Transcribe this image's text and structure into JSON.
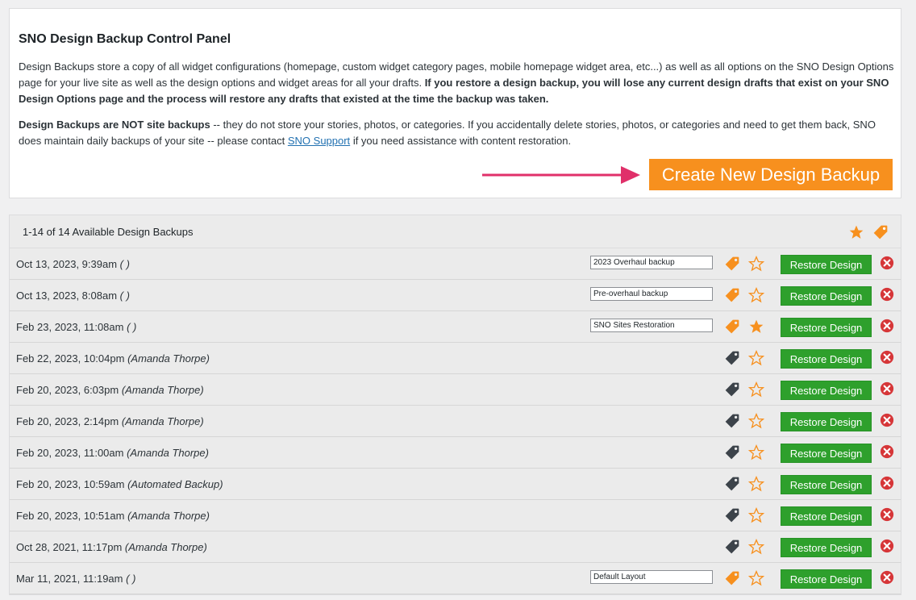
{
  "panel": {
    "title": "SNO Design Backup Control Panel",
    "p1_text": "Design Backups store a copy of all widget configurations (homepage, custom widget category pages, mobile homepage widget area, etc...) as well as all options on the SNO Design Options page for your live site as well as the design options and widget areas for all your drafts.",
    "p1_bold": "If you restore a design backup, you will lose any current design drafts that exist on your SNO Design Options page and the process will restore any drafts that existed at the time the backup was taken.",
    "p2_bold": "Design Backups are NOT site backups",
    "p2_text": "-- they do not store your stories, photos, or categories. If you accidentally delete stories, photos, or categories and need to get them back, SNO does maintain daily backups of your site -- please contact",
    "p2_link": "SNO Support",
    "p2_tail": "if you need assistance with content restoration.",
    "create_button": "Create New Design Backup"
  },
  "list": {
    "count_label": "1-14 of 14 Available Design Backups",
    "restore_label": "Restore Design",
    "rows": [
      {
        "date": "Oct 13, 2023, 9:39am",
        "author": "( )",
        "note": "2023 Overhaul backup",
        "tagged": true,
        "starred": false
      },
      {
        "date": "Oct 13, 2023, 8:08am",
        "author": "( )",
        "note": "Pre-overhaul backup",
        "tagged": true,
        "starred": false
      },
      {
        "date": "Feb 23, 2023, 11:08am",
        "author": "( )",
        "note": "SNO Sites Restoration",
        "tagged": true,
        "starred": true
      },
      {
        "date": "Feb 22, 2023, 10:04pm",
        "author": "(Amanda Thorpe)",
        "note": "",
        "tagged": false,
        "starred": false
      },
      {
        "date": "Feb 20, 2023, 6:03pm",
        "author": "(Amanda Thorpe)",
        "note": "",
        "tagged": false,
        "starred": false
      },
      {
        "date": "Feb 20, 2023, 2:14pm",
        "author": "(Amanda Thorpe)",
        "note": "",
        "tagged": false,
        "starred": false
      },
      {
        "date": "Feb 20, 2023, 11:00am",
        "author": "(Amanda Thorpe)",
        "note": "",
        "tagged": false,
        "starred": false
      },
      {
        "date": "Feb 20, 2023, 10:59am",
        "author": "(Automated Backup)",
        "note": "",
        "tagged": false,
        "starred": false
      },
      {
        "date": "Feb 20, 2023, 10:51am",
        "author": "(Amanda Thorpe)",
        "note": "",
        "tagged": false,
        "starred": false
      },
      {
        "date": "Oct 28, 2021, 11:17pm",
        "author": "(Amanda Thorpe)",
        "note": "",
        "tagged": false,
        "starred": false
      },
      {
        "date": "Mar 11, 2021, 11:19am",
        "author": "( )",
        "note": "Default Layout",
        "tagged": true,
        "starred": false
      }
    ]
  },
  "colors": {
    "accent_orange": "#f7901e",
    "restore_green": "#2ea02c",
    "delete_red": "#d63638",
    "arrow_pink": "#e0306a",
    "tag_dark": "#3c434a"
  },
  "icons": {
    "header_star": "star-filled-icon",
    "header_tag": "tag-icon",
    "row_tag": "tag-icon",
    "row_star": "star-icon",
    "row_delete": "delete-circle-icon",
    "arrow": "arrow-right-icon"
  }
}
